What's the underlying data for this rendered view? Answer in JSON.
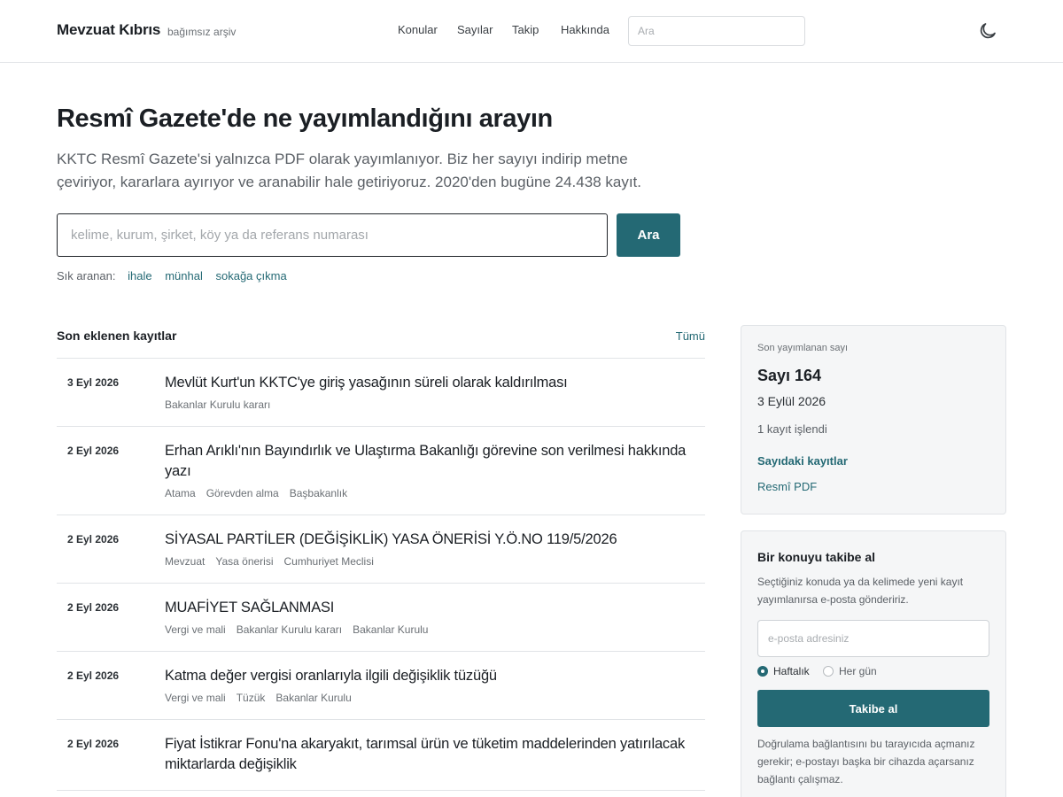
{
  "header": {
    "brand": "Mevzuat Kıbrıs",
    "brand_tagline": "bağımsız arşiv",
    "nav": [
      "Konular",
      "Sayılar",
      "Takip",
      "Hakkında"
    ],
    "search_placeholder": "Ara",
    "theme_icon": "moon-icon"
  },
  "hero": {
    "title": "Resmî Gazete'de ne yayımlandığını arayın",
    "description": "KKTC Resmî Gazete'si yalnızca PDF olarak yayımlanıyor. Biz her sayıyı indirip metne çeviriyor, kararlara ayırıyor ve aranabilir hale getiriyoruz. 2020'den bugüne 24.438 kayıt.",
    "search_placeholder": "kelime, kurum, şirket, köy ya da referans numarası",
    "search_button": "Ara",
    "frequent_label": "Sık aranan:",
    "frequent_terms": [
      "ihale",
      "münhal",
      "sokağa çıkma"
    ]
  },
  "records": {
    "title": "Son eklenen kayıtlar",
    "all_link": "Tümü",
    "items": [
      {
        "date": "3 Eyl 2026",
        "title": "Mevlüt Kurt'un KKTC'ye giriş yasağının süreli olarak kaldırılması",
        "tags": [
          "Bakanlar Kurulu kararı"
        ]
      },
      {
        "date": "2 Eyl 2026",
        "title": "Erhan Arıklı'nın Bayındırlık ve Ulaştırma Bakanlığı görevine son verilmesi hakkında yazı",
        "tags": [
          "Atama",
          "Görevden alma",
          "Başbakanlık"
        ]
      },
      {
        "date": "2 Eyl 2026",
        "title": "SİYASAL PARTİLER (DEĞİŞİKLİK) YASA ÖNERİSİ Y.Ö.NO 119/5/2026",
        "tags": [
          "Mevzuat",
          "Yasa önerisi",
          "Cumhuriyet Meclisi"
        ]
      },
      {
        "date": "2 Eyl 2026",
        "title": "MUAFİYET SAĞLANMASI",
        "tags": [
          "Vergi ve mali",
          "Bakanlar Kurulu kararı",
          "Bakanlar Kurulu"
        ]
      },
      {
        "date": "2 Eyl 2026",
        "title": "Katma değer vergisi oranlarıyla ilgili değişiklik tüzüğü",
        "tags": [
          "Vergi ve mali",
          "Tüzük",
          "Bakanlar Kurulu"
        ]
      },
      {
        "date": "2 Eyl 2026",
        "title": "Fiyat İstikrar Fonu'na akaryakıt, tarımsal ürün ve tüketim maddelerinden yatırılacak miktarlarda değişiklik",
        "tags": []
      }
    ]
  },
  "latest_issue": {
    "label": "Son yayımlanan sayı",
    "issue": "Sayı 164",
    "date": "3 Eylül 2026",
    "count": "1 kayıt işlendi",
    "records_link": "Sayıdaki kayıtlar",
    "pdf_link": "Resmî PDF"
  },
  "follow": {
    "title": "Bir konuyu takibe al",
    "description": "Seçtiğiniz konuda ya da kelimede yeni kayıt yayımlanırsa e-posta göndeririz.",
    "email_placeholder": "e-posta adresiniz",
    "options": [
      "Haftalık",
      "Her gün"
    ],
    "selected_option": "Haftalık",
    "button": "Takibe al",
    "note": "Doğrulama bağlantısını bu tarayıcıda açmanız gerekir; e-postayı başka bir cihazda açarsanız bağlantı çalışmaz."
  },
  "colors": {
    "accent": "#246974",
    "text": "#1b1f24",
    "muted": "#5b6066",
    "card_bg": "#f5f6f7"
  }
}
